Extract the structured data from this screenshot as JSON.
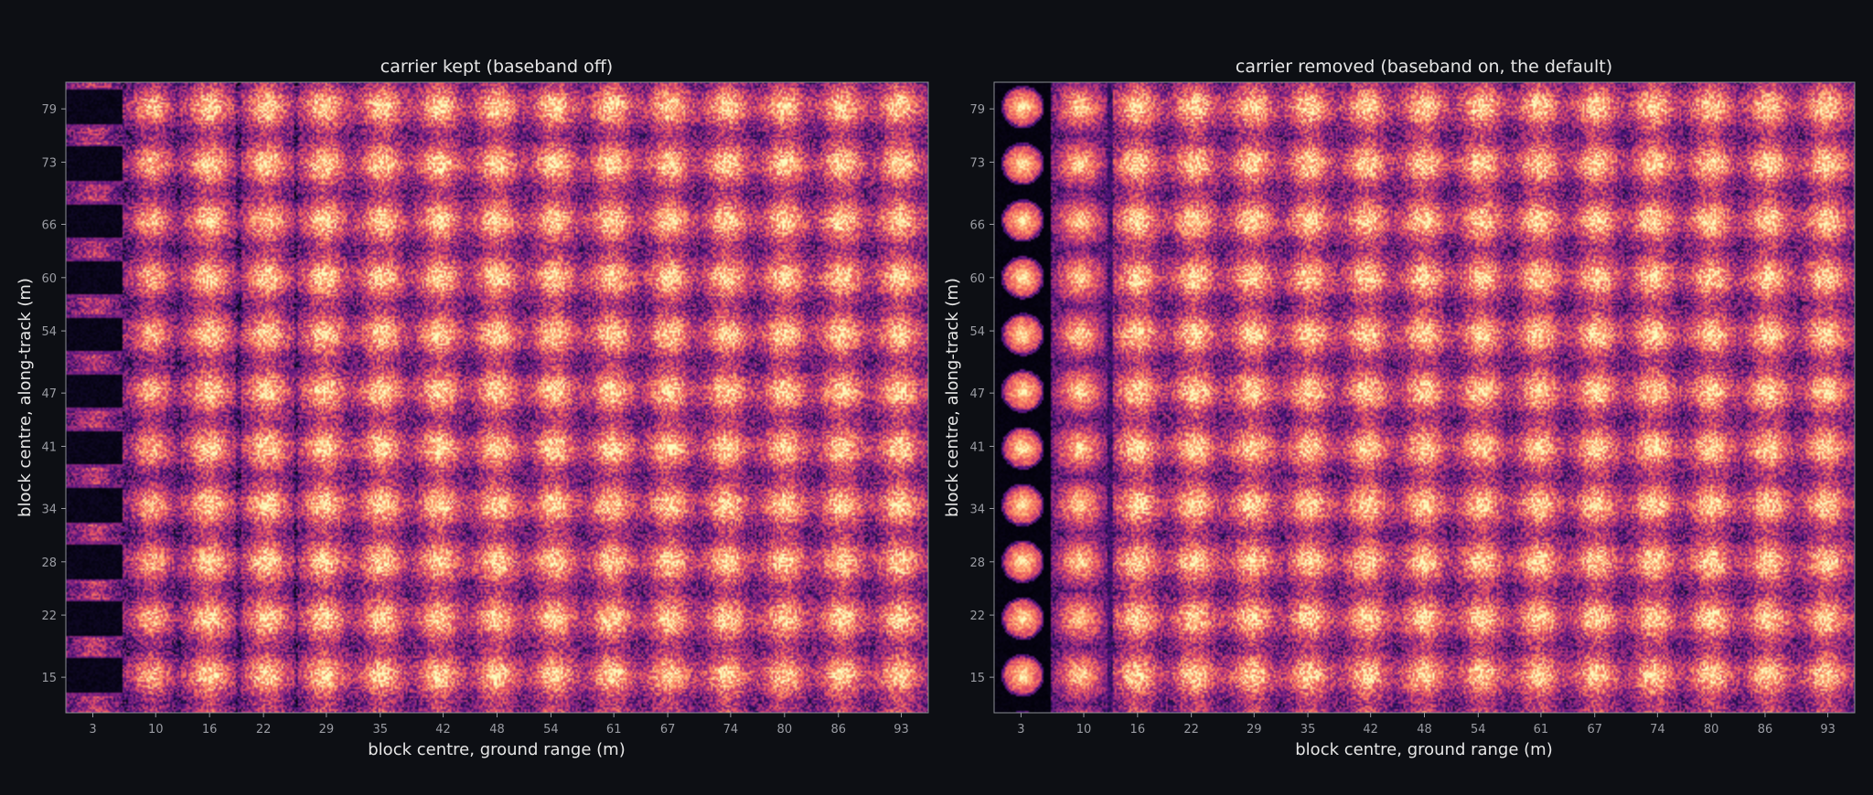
{
  "colors": {
    "background": "#0d0f14",
    "colormap": "magma",
    "text": "#e6e6e6",
    "tick": "#9a9ca3"
  },
  "chart_data": [
    {
      "type": "heatmap",
      "title": "carrier kept (baseband off)",
      "xlabel": "block centre, ground range (m)",
      "ylabel": "block centre, along-track (m)",
      "x_ticks": [
        "3",
        "10",
        "16",
        "22",
        "29",
        "35",
        "42",
        "48",
        "54",
        "61",
        "67",
        "74",
        "80",
        "86",
        "93"
      ],
      "y_ticks": [
        "15",
        "22",
        "28",
        "34",
        "41",
        "47",
        "54",
        "60",
        "66",
        "73",
        "79"
      ],
      "xlim": [
        0,
        96
      ],
      "ylim": [
        11,
        82
      ],
      "grid": false,
      "colorbar": false,
      "pattern": "periodic bright blobs over a noisy field; first range column shows dark horizontal bands (carrier stripes); faint vertical seams near 19 m and 26 m",
      "period_x_m": 6.4,
      "period_y_m": 6.4,
      "mode": "carrier"
    },
    {
      "type": "heatmap",
      "title": "carrier removed (baseband on, the default)",
      "xlabel": "block centre, ground range (m)",
      "ylabel": "block centre, along-track (m)",
      "x_ticks": [
        "3",
        "10",
        "16",
        "22",
        "29",
        "35",
        "42",
        "48",
        "54",
        "61",
        "67",
        "74",
        "80",
        "86",
        "93"
      ],
      "y_ticks": [
        "15",
        "22",
        "28",
        "34",
        "41",
        "47",
        "54",
        "60",
        "66",
        "73",
        "79"
      ],
      "xlim": [
        0,
        96
      ],
      "ylim": [
        11,
        82
      ],
      "grid": false,
      "colorbar": false,
      "pattern": "periodic bright blobs over a noisy field; first range column shows isolated round spots on black; dark seam near 13 m",
      "period_x_m": 6.4,
      "period_y_m": 6.4,
      "mode": "baseband"
    }
  ]
}
